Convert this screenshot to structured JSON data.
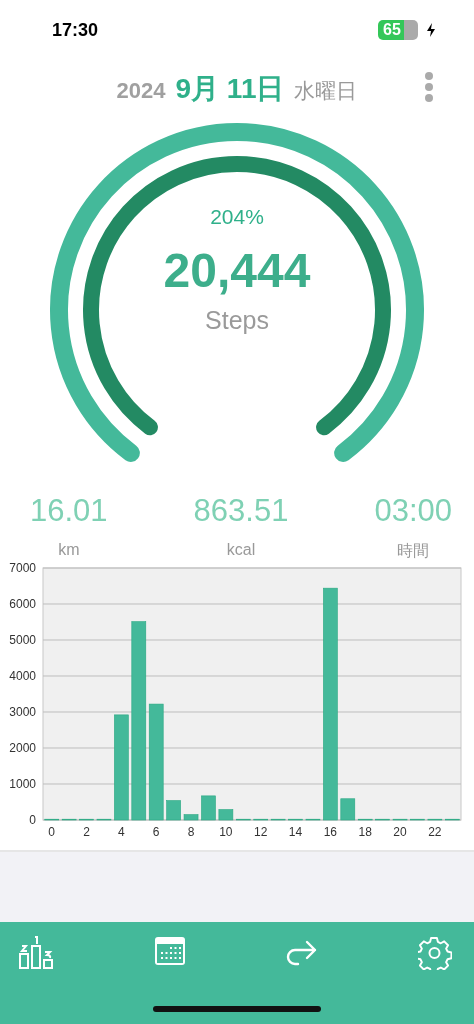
{
  "status_bar": {
    "time": "17:30",
    "battery": "65"
  },
  "date": {
    "year": "2024",
    "day": "9月 11日",
    "weekday": "水曜日"
  },
  "gauge": {
    "percent": "204%",
    "steps": "20,444",
    "unit": "Steps"
  },
  "stats": [
    {
      "value": "16.01",
      "label": "km"
    },
    {
      "value": "863.51",
      "label": "kcal"
    },
    {
      "value": "03:00",
      "label": "時間"
    }
  ],
  "chart_data": {
    "type": "bar",
    "x": [
      0,
      1,
      2,
      3,
      4,
      5,
      6,
      7,
      8,
      9,
      10,
      11,
      12,
      13,
      14,
      15,
      16,
      17,
      18,
      19,
      20,
      21,
      22,
      23
    ],
    "xlim": [
      -0.5,
      23.5
    ],
    "grid": true,
    "series": [
      {
        "color": "#44b99a",
        "values": [
          0,
          0,
          0,
          0,
          2920,
          5510,
          3220,
          540,
          150,
          670,
          290,
          0,
          0,
          0,
          0,
          0,
          6440,
          590,
          0,
          0,
          0,
          0,
          0,
          0
        ]
      }
    ],
    "ylim": [
      0,
      7000
    ],
    "yticks": [
      0,
      1000,
      2000,
      3000,
      4000,
      5000,
      6000,
      7000
    ],
    "xticks": [
      0,
      2,
      4,
      6,
      8,
      10,
      12,
      14,
      16,
      18,
      20,
      22
    ]
  },
  "tab_bar": [
    {
      "kind": "ranking"
    },
    {
      "kind": "calendar"
    },
    {
      "kind": "share"
    },
    {
      "kind": "settings"
    }
  ]
}
